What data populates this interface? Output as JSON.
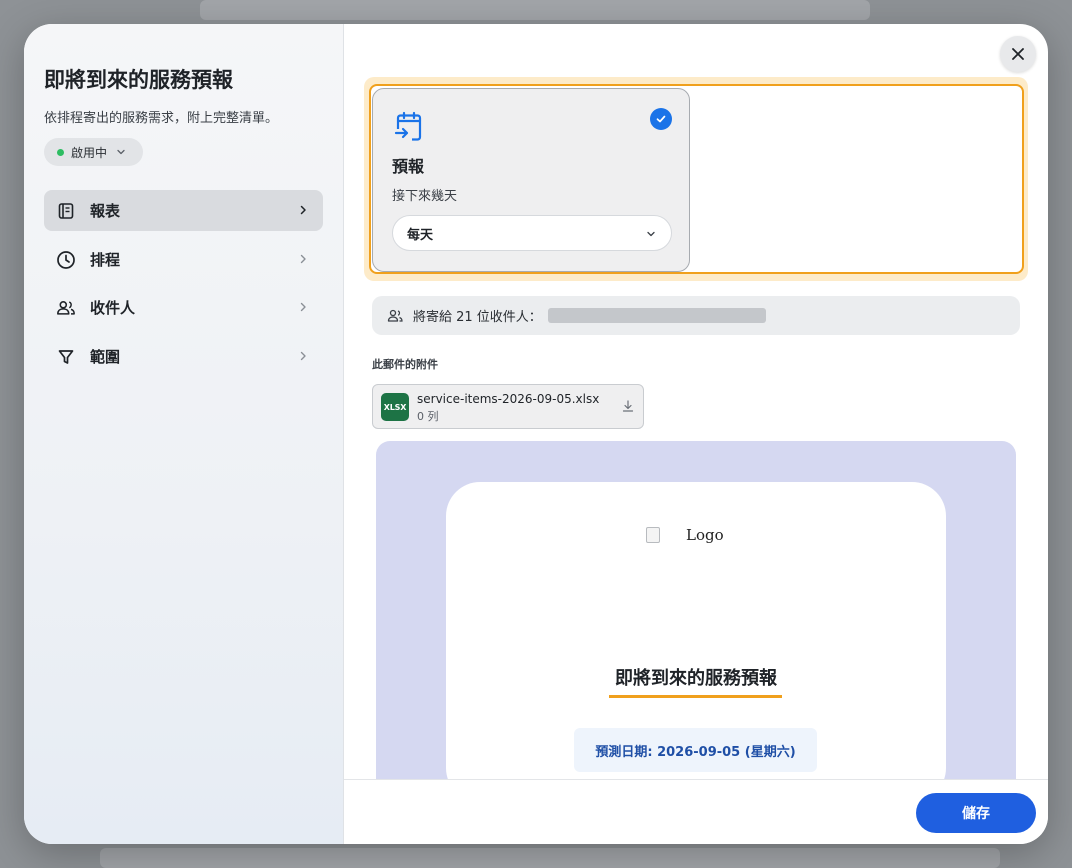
{
  "modal": {
    "title": "即將到來的服務預報",
    "subtitle": "依排程寄出的服務需求，附上完整清單。",
    "status_label": "啟用中"
  },
  "nav": {
    "items": [
      {
        "label": "報表",
        "icon": "report-icon",
        "active": true
      },
      {
        "label": "排程",
        "icon": "clock-icon",
        "active": false
      },
      {
        "label": "收件人",
        "icon": "people-icon",
        "active": false
      },
      {
        "label": "範圍",
        "icon": "filter-icon",
        "active": false
      }
    ]
  },
  "report_option": {
    "title": "預報",
    "subtitle": "接下來幾天",
    "frequency": "每天",
    "selected": true
  },
  "recipients": {
    "text": "將寄給 21 位收件人："
  },
  "attachments": {
    "heading": "此郵件的附件",
    "file_badge": "XLSX",
    "file_name": "service-items-2026-09-05.xlsx",
    "row_count": "0 列"
  },
  "email_preview": {
    "logo_alt": "Logo",
    "title": "即將到來的服務預報",
    "date_text": "預測日期: 2026-09-05 (星期六)"
  },
  "footer": {
    "save_label": "儲存"
  },
  "colors": {
    "accent": "#1f5fe0",
    "check": "#1a73e8",
    "highlight": "#f0a01c",
    "active_status": "#2dbd62",
    "excel_green": "#1d7345",
    "preview_bg": "#d5d8f1"
  }
}
